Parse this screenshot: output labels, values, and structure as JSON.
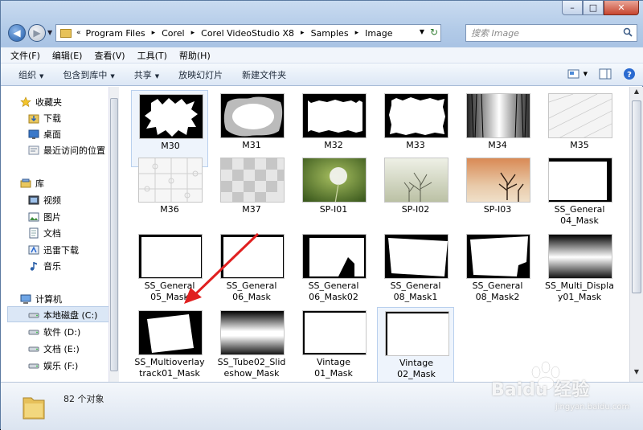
{
  "window": {
    "buttons": {
      "minimize": "–",
      "maximize": "□",
      "close": "✕"
    }
  },
  "address": {
    "breadcrumbs": [
      "Program Files",
      "Corel",
      "Corel VideoStudio X8",
      "Samples",
      "Image"
    ]
  },
  "search": {
    "placeholder": "搜索 Image"
  },
  "menubar": [
    "文件(F)",
    "编辑(E)",
    "查看(V)",
    "工具(T)",
    "帮助(H)"
  ],
  "toolbar": {
    "organize": "组织",
    "include_library": "包含到库中",
    "share": "共享",
    "slideshow": "放映幻灯片",
    "new_folder": "新建文件夹"
  },
  "sidebar": {
    "favorites": "收藏夹",
    "downloads": "下载",
    "desktop": "桌面",
    "recent": "最近访问的位置",
    "libraries": "库",
    "videos": "视频",
    "pictures": "图片",
    "documents": "文档",
    "xunlei": "迅雷下载",
    "music": "音乐",
    "computer": "计算机",
    "local_c": "本地磁盘 (C:)",
    "soft_d": "软件 (D:)",
    "doc_e": "文档 (E:)",
    "ent_f": "娱乐 (F:)"
  },
  "files": [
    {
      "name": "M30"
    },
    {
      "name": "M31"
    },
    {
      "name": "M32"
    },
    {
      "name": "M33"
    },
    {
      "name": "M34"
    },
    {
      "name": "M35"
    },
    {
      "name": "M36"
    },
    {
      "name": "M37"
    },
    {
      "name": "SP-I01"
    },
    {
      "name": "SP-I02"
    },
    {
      "name": "SP-I03"
    },
    {
      "name": "SS_General\n04_Mask"
    },
    {
      "name": "SS_General\n05_Mask"
    },
    {
      "name": "SS_General\n06_Mask"
    },
    {
      "name": "SS_General\n06_Mask02"
    },
    {
      "name": "SS_General\n08_Mask1"
    },
    {
      "name": "SS_General\n08_Mask2"
    },
    {
      "name": "SS_Multi_Displa\ny01_Mask"
    },
    {
      "name": "SS_Multioverlay\ntrack01_Mask"
    },
    {
      "name": "SS_Tube02_Slid\neshow_Mask"
    },
    {
      "name": "Vintage\n01_Mask"
    },
    {
      "name": "Vintage\n02_Mask"
    }
  ],
  "status": {
    "count": "82 个对象"
  },
  "watermark": {
    "brand": "Baidu 经验",
    "url": "jingyan.baidu.com"
  }
}
